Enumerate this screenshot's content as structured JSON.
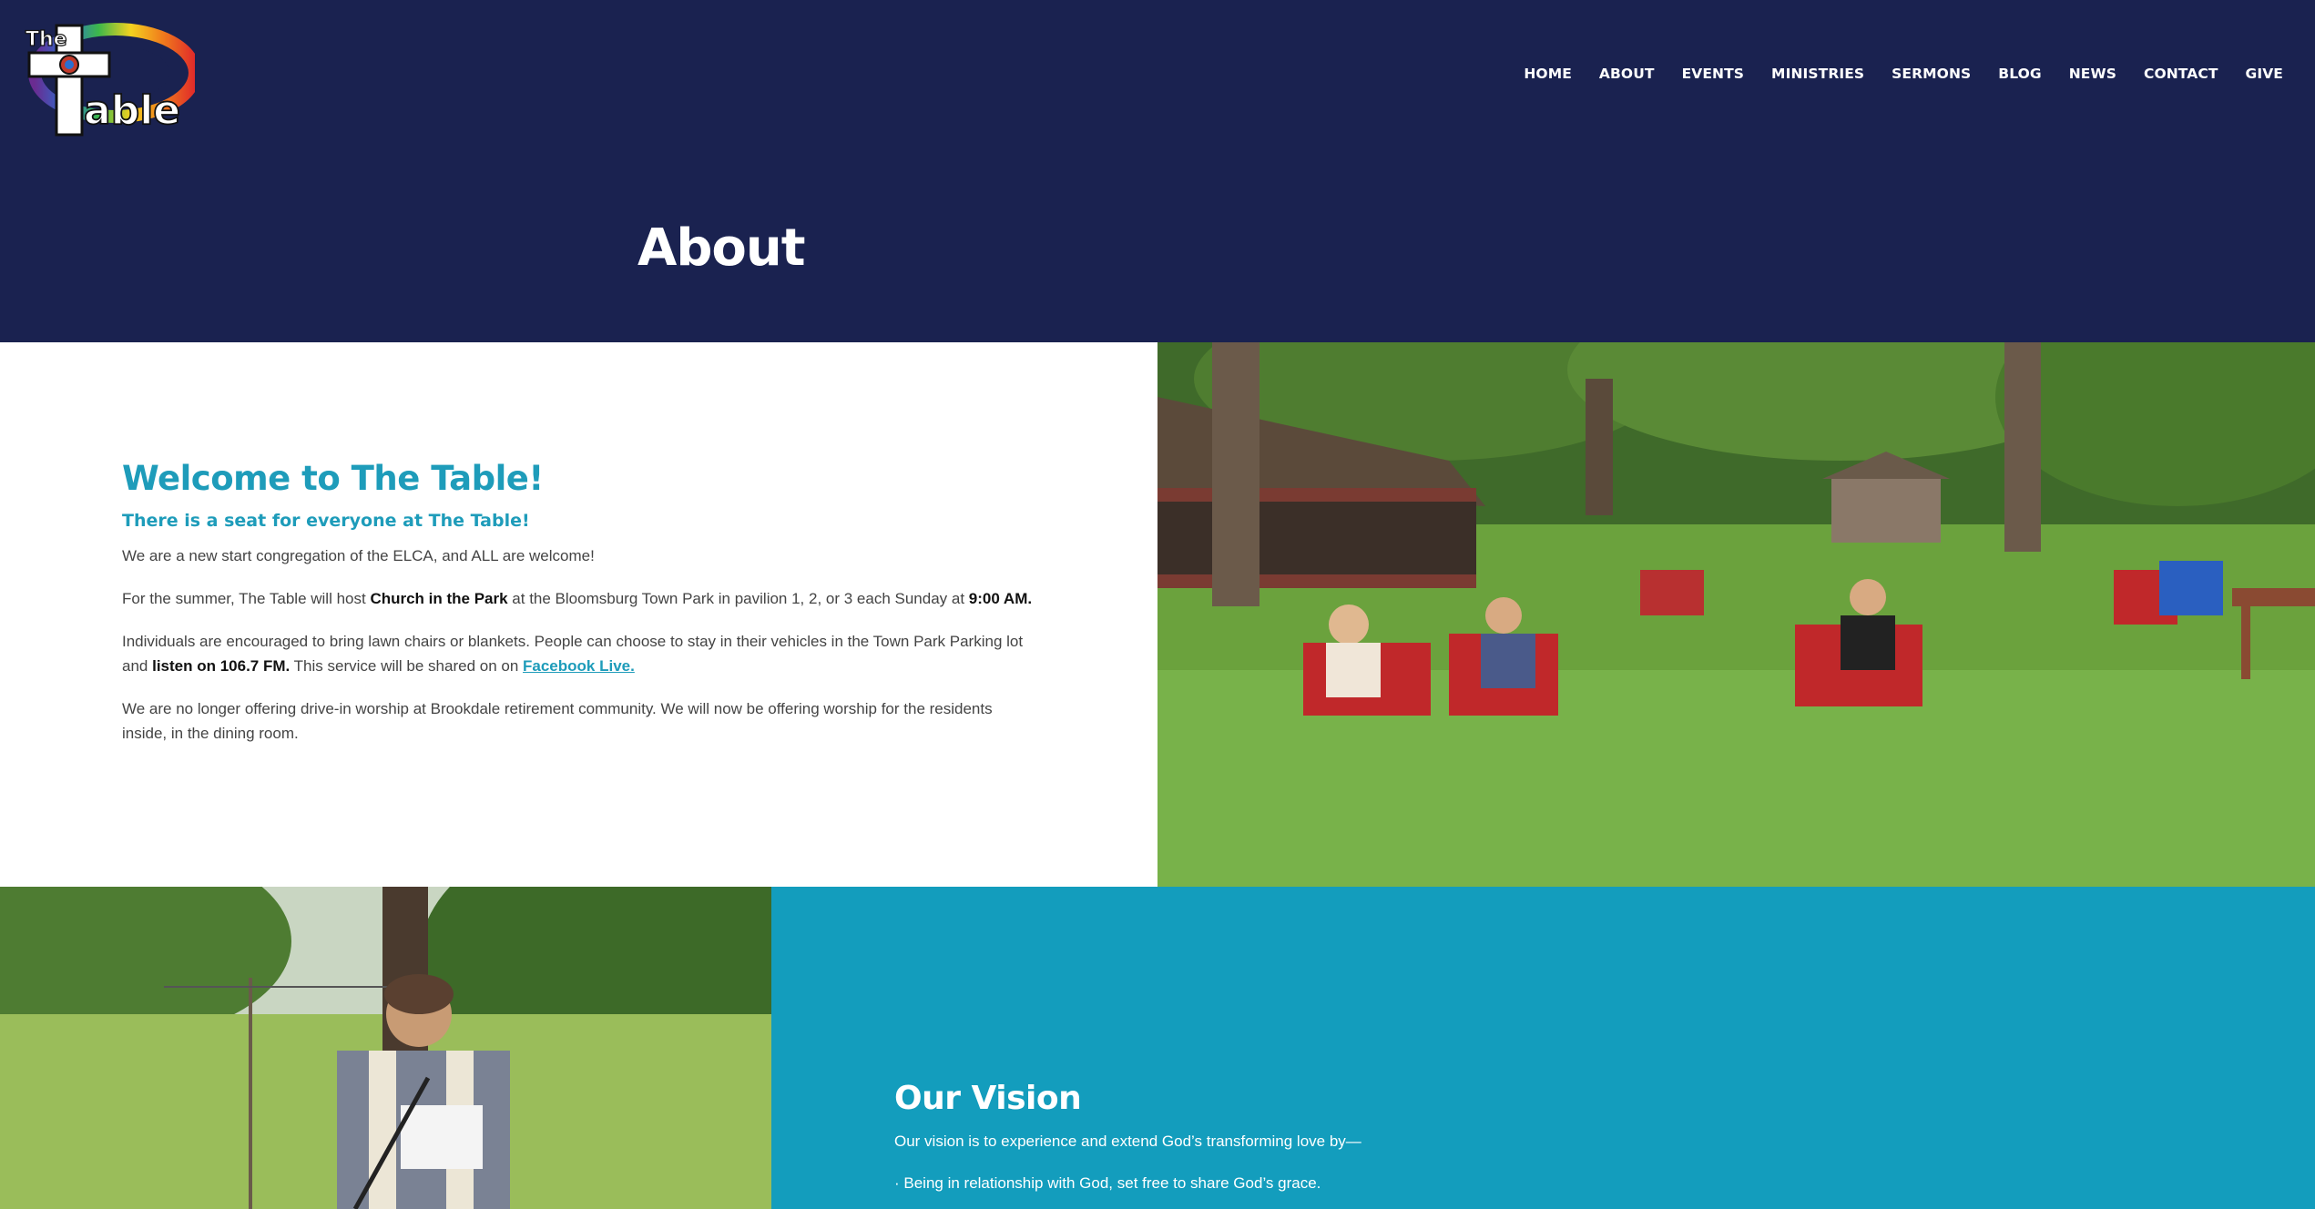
{
  "brand": {
    "logo_alt": "The Table",
    "logo_word_top": "The",
    "logo_word_main": "able"
  },
  "nav": {
    "items": [
      "HOME",
      "ABOUT",
      "EVENTS",
      "MINISTRIES",
      "SERMONS",
      "BLOG",
      "NEWS",
      "CONTACT",
      "GIVE"
    ]
  },
  "hero": {
    "title": "About"
  },
  "welcome": {
    "heading": "Welcome to The Table!",
    "subheading": "There is a seat for everyone at The Table!",
    "p1": "We are a new start congregation of the ELCA, and ALL are welcome!",
    "p2_pre": "For the summer, The Table will host ",
    "p2_bold1": "Church in the Park",
    "p2_mid": " at the Bloomsburg Town Park in pavilion 1, 2, or 3 each Sunday at ",
    "p2_bold2": "9:00 AM.",
    "p3_pre": "Individuals are encouraged to bring lawn chairs or blankets. People can choose to stay in their vehicles in the Town Park Parking lot and ",
    "p3_bold": "listen on 106.7 FM.",
    "p3_mid": "  This service will be shared on on ",
    "p3_link": "Facebook Live.",
    "p4": "We are no longer offering drive-in worship at Brookdale retirement community. We will now be offering worship for the residents inside, in the dining room."
  },
  "vision": {
    "heading": "Our Vision",
    "intro": "Our vision is to experience and extend God’s transforming love by—",
    "bullet1": "· Being in relationship with God, set free to share God’s grace."
  },
  "colors": {
    "header_bg": "#1a2250",
    "accent": "#1e9cba",
    "vision_bg": "#139dbd"
  }
}
